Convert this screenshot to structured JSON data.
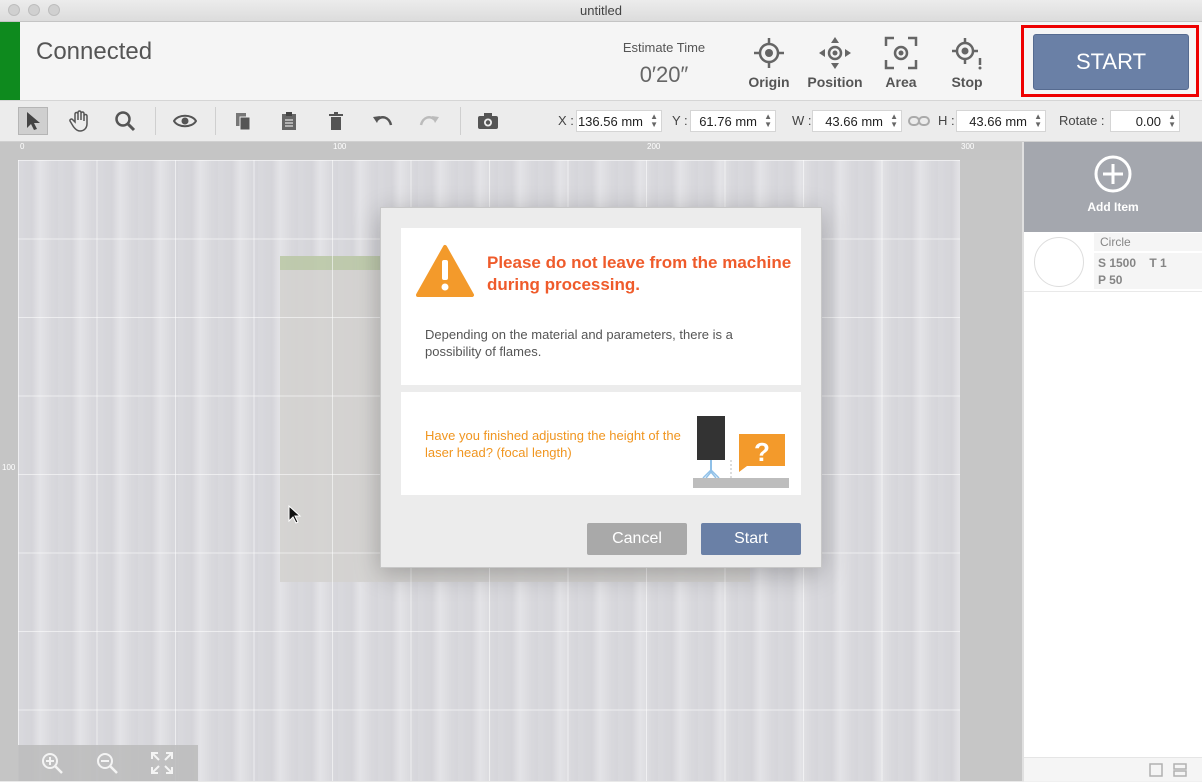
{
  "window": {
    "title": "untitled"
  },
  "topbar": {
    "status": "Connected",
    "estimate_label": "Estimate Time",
    "estimate_value": "0′20″",
    "buttons": [
      {
        "label": "Origin",
        "icon": "origin-target-icon"
      },
      {
        "label": "Position",
        "icon": "position-move-icon"
      },
      {
        "label": "Area",
        "icon": "area-frame-icon"
      },
      {
        "label": "Stop",
        "icon": "stop-target-icon"
      }
    ],
    "start_label": "START"
  },
  "colors": {
    "connected": "#0e8a1e",
    "start_button": "#6a80a6",
    "highlight": "#e00000",
    "warning_title": "#ef5b2b",
    "warning_icon": "#f39a2b",
    "focus_text": "#f0951f"
  },
  "toolbar": {
    "tools": [
      "select-arrow-icon",
      "hand-pan-icon",
      "zoom-search-icon",
      "eye-preview-icon",
      "copy-icon",
      "paste-icon",
      "trash-icon",
      "undo-icon",
      "redo-icon",
      "camera-icon"
    ],
    "x_label": "X :",
    "x_value": "136.56 mm",
    "y_label": "Y :",
    "y_value": "61.76 mm",
    "w_label": "W :",
    "w_value": "43.66 mm",
    "h_label": "H :",
    "h_value": "43.66 mm",
    "rotate_label": "Rotate :",
    "rotate_value": "0.00"
  },
  "rulers": {
    "top": [
      "0",
      "100",
      "200",
      "300"
    ],
    "left": [
      "100"
    ]
  },
  "zoom": [
    "zoom-in-icon",
    "zoom-out-icon",
    "fit-screen-icon"
  ],
  "panel": {
    "add_item_label": "Add Item",
    "items": [
      {
        "name": "Circle",
        "params_line1": "S 1500    T 1",
        "params_line2": "P 50"
      }
    ]
  },
  "dialog": {
    "warning_title": "Please do not leave from the machine during processing.",
    "warning_body": "Depending on the material and parameters, there is a possibility of flames.",
    "focus_question": "Have you finished adjusting the height of the laser head?  (focal length)",
    "cancel_label": "Cancel",
    "start_label": "Start"
  }
}
